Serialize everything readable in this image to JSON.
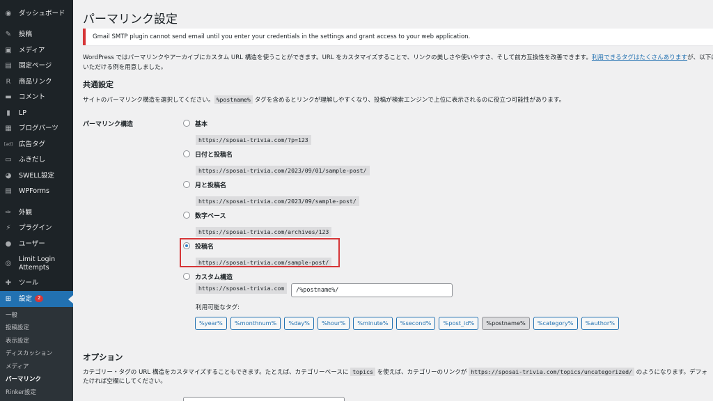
{
  "sidebar": {
    "items": [
      {
        "label": "ダッシュボード",
        "icon": "dashboard-icon",
        "glyph": "◉"
      },
      {
        "label": "投稿",
        "icon": "pin-icon",
        "glyph": "✎"
      },
      {
        "label": "メディア",
        "icon": "media-icon",
        "glyph": "▣"
      },
      {
        "label": "固定ページ",
        "icon": "page-icon",
        "glyph": "▤"
      },
      {
        "label": "商品リンク",
        "icon": "r-icon",
        "glyph": "R"
      },
      {
        "label": "コメント",
        "icon": "comment-icon",
        "glyph": "▬"
      },
      {
        "label": "LP",
        "icon": "document-icon",
        "glyph": "▮"
      },
      {
        "label": "ブログパーツ",
        "icon": "layout-icon",
        "glyph": "▦"
      },
      {
        "label": "広告タグ",
        "icon": "ad-icon",
        "glyph": "[ad]"
      },
      {
        "label": "ふきだし",
        "icon": "balloon-icon",
        "glyph": "▭"
      },
      {
        "label": "SWELL設定",
        "icon": "swell-icon",
        "glyph": "◕"
      },
      {
        "label": "WPForms",
        "icon": "wpforms-icon",
        "glyph": "▤"
      },
      {
        "label": "外観",
        "icon": "brush-icon",
        "glyph": "✑"
      },
      {
        "label": "プラグイン",
        "icon": "plugin-icon",
        "glyph": "⚡"
      },
      {
        "label": "ユーザー",
        "icon": "user-icon",
        "glyph": "●"
      },
      {
        "label": "Limit Login Attempts",
        "icon": "fingerprint-icon",
        "glyph": "◎"
      },
      {
        "label": "ツール",
        "icon": "wrench-icon",
        "glyph": "✚"
      },
      {
        "label": "設定",
        "icon": "settings-icon",
        "glyph": "⊞",
        "badge": "2"
      }
    ],
    "submenu": [
      "一般",
      "投稿設定",
      "表示設定",
      "ディスカッション",
      "メディア",
      "パーマリンク",
      "Rinker設定"
    ]
  },
  "page": {
    "title": "パーマリンク設定",
    "notice": "Gmail SMTP plugin cannot send email until you enter your credentials in the settings and grant access to your web application.",
    "intro_line1": "WordPress ではパーマリンクやアーカイブにカスタム URL 構造を使うことができます。URL をカスタマイズすることで、リンクの美しさや使いやすさ、そして前方互換性を改善できます。",
    "intro_link": "利用できるタグはたくさんあります",
    "intro_line1_tail": "が、以下に",
    "intro_line2": "いただける例を用意しました。",
    "common_heading": "共通設定",
    "common_desc_pre": "サイトのパーマリンク構造を選択してください。",
    "common_desc_code": "%postname%",
    "common_desc_post": " タグを含めるとリンクが理解しやすくなり、投稿が検索エンジンで上位に表示されるのに役立つ可能性があります。",
    "structure_label": "パーマリンク構造"
  },
  "options": [
    {
      "label": "基本",
      "url": "https://sposai-trivia.com/?p=123",
      "checked": false
    },
    {
      "label": "日付と投稿名",
      "url": "https://sposai-trivia.com/2023/09/01/sample-post/",
      "checked": false
    },
    {
      "label": "月と投稿名",
      "url": "https://sposai-trivia.com/2023/09/sample-post/",
      "checked": false
    },
    {
      "label": "数字ベース",
      "url": "https://sposai-trivia.com/archives/123",
      "checked": false
    },
    {
      "label": "投稿名",
      "url": "https://sposai-trivia.com/sample-post/",
      "checked": true
    },
    {
      "label": "カスタム構造",
      "checked": false
    }
  ],
  "custom": {
    "prefix": "https://sposai-trivia.com",
    "value": "/%postname%/",
    "available_tags_label": "利用可能なタグ:",
    "tags": [
      "%year%",
      "%monthnum%",
      "%day%",
      "%hour%",
      "%minute%",
      "%second%",
      "%post_id%",
      "%postname%",
      "%category%",
      "%author%"
    ],
    "active_tag": "%postname%"
  },
  "optional": {
    "heading": "オプション",
    "desc_pre": "カテゴリー・タグの URL 構造をカスタマイズすることもできます。たとえば、カテゴリーベースに ",
    "desc_code1": "topics",
    "desc_mid": " を使えば、カテゴリーのリンクが ",
    "desc_code2": "https://sposai-trivia.com/topics/uncategorized/",
    "desc_post": " のようになります。デフォ",
    "desc_line2": "たければ空欄にしてください。"
  },
  "colors": {
    "accent": "#2271b1",
    "highlight": "#d63638",
    "sidebar": "#1d2327"
  }
}
